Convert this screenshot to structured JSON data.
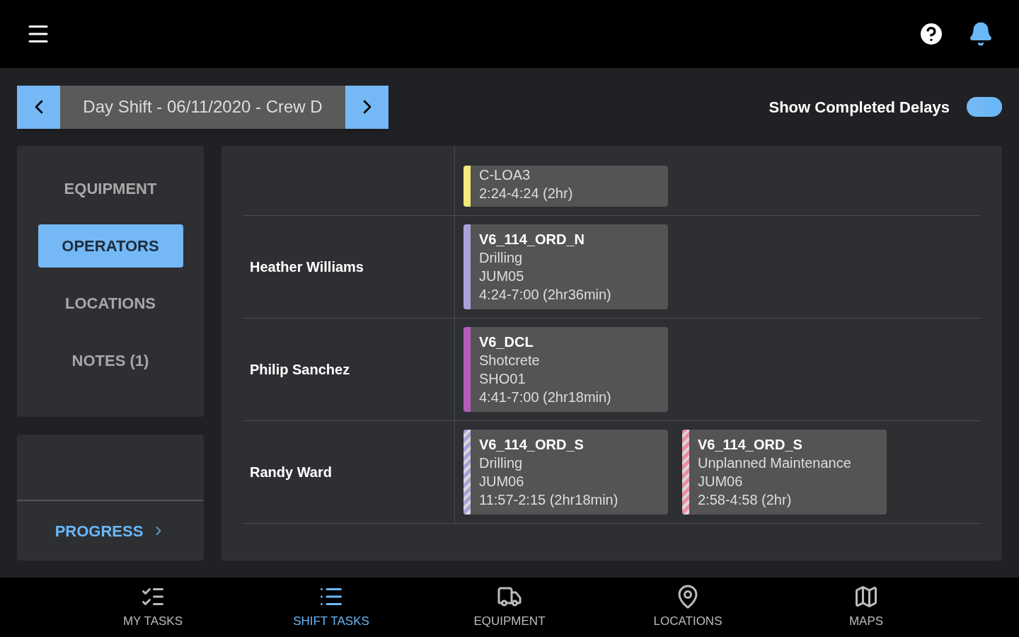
{
  "shift_selector": {
    "label": "Day Shift - 06/11/2020 - Crew D"
  },
  "show_completed_delays": {
    "label": "Show Completed Delays",
    "on": true
  },
  "sidebar": {
    "items": [
      {
        "label": "EQUIPMENT",
        "selected": false
      },
      {
        "label": "OPERATORS",
        "selected": true
      },
      {
        "label": "LOCATIONS",
        "selected": false
      },
      {
        "label": "NOTES (1)",
        "selected": false
      }
    ]
  },
  "progress_link": {
    "label": "PROGRESS"
  },
  "operators": [
    {
      "tasks": [
        {
          "lines": [
            "C-LOA3",
            "2:24-4:24 (2hr)"
          ],
          "color": "#f2ea7a",
          "striped": false,
          "cut_top": true
        }
      ]
    },
    {
      "name": "Heather Williams",
      "tasks": [
        {
          "title": "V6_114_ORD_N",
          "lines": [
            "Drilling",
            "JUM05",
            "4:24-7:00 (2hr36min)"
          ],
          "color": "#a9a3dc",
          "striped": false
        }
      ]
    },
    {
      "name": "Philip Sanchez",
      "tasks": [
        {
          "title": "V6_DCL",
          "lines": [
            "Shotcrete",
            "SHO01",
            "4:41-7:00 (2hr18min)"
          ],
          "color": "#b35dbb",
          "striped": false
        }
      ]
    },
    {
      "name": "Randy Ward",
      "tasks": [
        {
          "title": "V6_114_ORD_S",
          "lines": [
            "Drilling",
            "JUM06",
            "11:57-2:15 (2hr18min)"
          ],
          "color": "#a9a3dc",
          "striped": true
        },
        {
          "title": "V6_114_ORD_S",
          "lines": [
            "Unplanned Maintenance",
            "JUM06",
            "2:58-4:58 (2hr)"
          ],
          "color": "#f08ca0",
          "striped": true
        }
      ]
    }
  ],
  "bottom_nav": [
    {
      "label": "MY TASKS",
      "selected": false
    },
    {
      "label": "SHIFT TASKS",
      "selected": true
    },
    {
      "label": "EQUIPMENT",
      "selected": false
    },
    {
      "label": "LOCATIONS",
      "selected": false
    },
    {
      "label": "MAPS",
      "selected": false
    }
  ]
}
